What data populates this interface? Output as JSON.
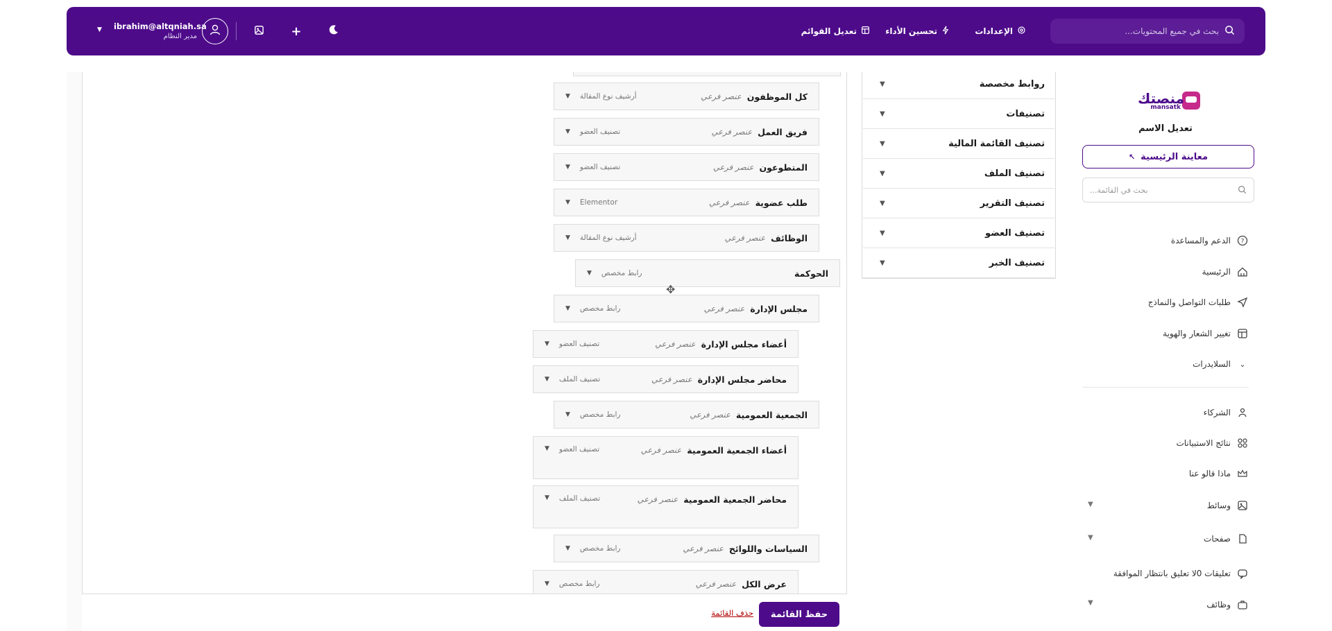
{
  "header": {
    "search_placeholder": "بحث في جميع المحتويات...",
    "links": [
      {
        "label": "الإعدادات",
        "icon": "gear-icon"
      },
      {
        "label": "تحسين الأداء",
        "icon": "bolt-icon"
      },
      {
        "label": "تعديل القوائم",
        "icon": "layout-icon"
      }
    ],
    "user_email": "ibrahim@altqniah.sa",
    "user_role": "مدير النظام"
  },
  "sidebar": {
    "logo_text": "منصتك",
    "logo_sub": "mansatk",
    "edit_name": "تعديل الاسم",
    "preview_label": "معاينة الرئيسية",
    "search_placeholder": "بحث في القائمة...",
    "items": [
      {
        "label": "الدعم والمساعدة",
        "icon": "help-circle-icon"
      },
      {
        "label": "الرئيسية",
        "icon": "home-icon"
      },
      {
        "label": "طلبات التواصل والنماذج",
        "icon": "send-icon"
      },
      {
        "label": "تغيير الشعار والهوية",
        "icon": "layout-icon"
      },
      {
        "label": "السلايدرات",
        "icon": "chevron-down-icon"
      },
      {
        "label": "الشركاء",
        "icon": "handshake-icon"
      },
      {
        "label": "نتائج الاستبيانات",
        "icon": "grid-icon"
      },
      {
        "label": "ماذا قالو عنا",
        "icon": "crown-icon"
      },
      {
        "label": "وسائط",
        "icon": "image-icon"
      },
      {
        "label": "صفحات",
        "icon": "page-icon"
      },
      {
        "label": "تعليقات 0لا تعليق بانتظار الموافقة",
        "icon": "comment-icon"
      },
      {
        "label": "وظائف",
        "icon": "briefcase-icon"
      }
    ]
  },
  "categories": [
    {
      "label": "روابط مخصصة"
    },
    {
      "label": "تصنيفات"
    },
    {
      "label": "تصنيف القائمة المالية"
    },
    {
      "label": "تصنيف الملف"
    },
    {
      "label": "تصنيف التقرير"
    },
    {
      "label": "تصنيف العضو"
    },
    {
      "label": "تصنيف الخبر"
    }
  ],
  "menu_items": [
    {
      "title": "كل الموظفون",
      "kind": "عنصر فرعي",
      "type": "أرشيف نوع المقالة"
    },
    {
      "title": "فريق العمل",
      "kind": "عنصر فرعي",
      "type": "تصنيف العضو"
    },
    {
      "title": "المتطوعون",
      "kind": "عنصر فرعي",
      "type": "تصنيف العضو"
    },
    {
      "title": "طلب عضوية",
      "kind": "عنصر فرعي",
      "type": "Elementor"
    },
    {
      "title": "الوظائف",
      "kind": "عنصر فرعي",
      "type": "أرشيف نوع المقالة"
    },
    {
      "title": "الحوكمة",
      "kind": "",
      "type": "رابط مخصص"
    },
    {
      "title": "مجلس الإدارة",
      "kind": "عنصر فرعي",
      "type": "رابط مخصص"
    },
    {
      "title": "أعضاء مجلس الإدارة",
      "kind": "عنصر فرعي",
      "type": "تصنيف العضو"
    },
    {
      "title": "محاضر مجلس الإدارة",
      "kind": "عنصر فرعي",
      "type": "تصنيف الملف"
    },
    {
      "title": "الجمعية العمومية",
      "kind": "عنصر فرعي",
      "type": "رابط مخصص"
    },
    {
      "title": "أعضاء الجمعية العمومية",
      "kind": "عنصر فرعي",
      "type": "تصنيف العضو"
    },
    {
      "title": "محاضر الجمعية العمومية",
      "kind": "عنصر فرعي",
      "type": "تصنيف الملف"
    },
    {
      "title": "السياسات واللوائح",
      "kind": "عنصر فرعي",
      "type": "رابط مخصص"
    },
    {
      "title": "عرض الكل",
      "kind": "عنصر فرعي",
      "type": "رابط مخصص"
    }
  ],
  "footer": {
    "save_label": "حفظ القائمة",
    "delete_label": "حذف القائمة"
  }
}
